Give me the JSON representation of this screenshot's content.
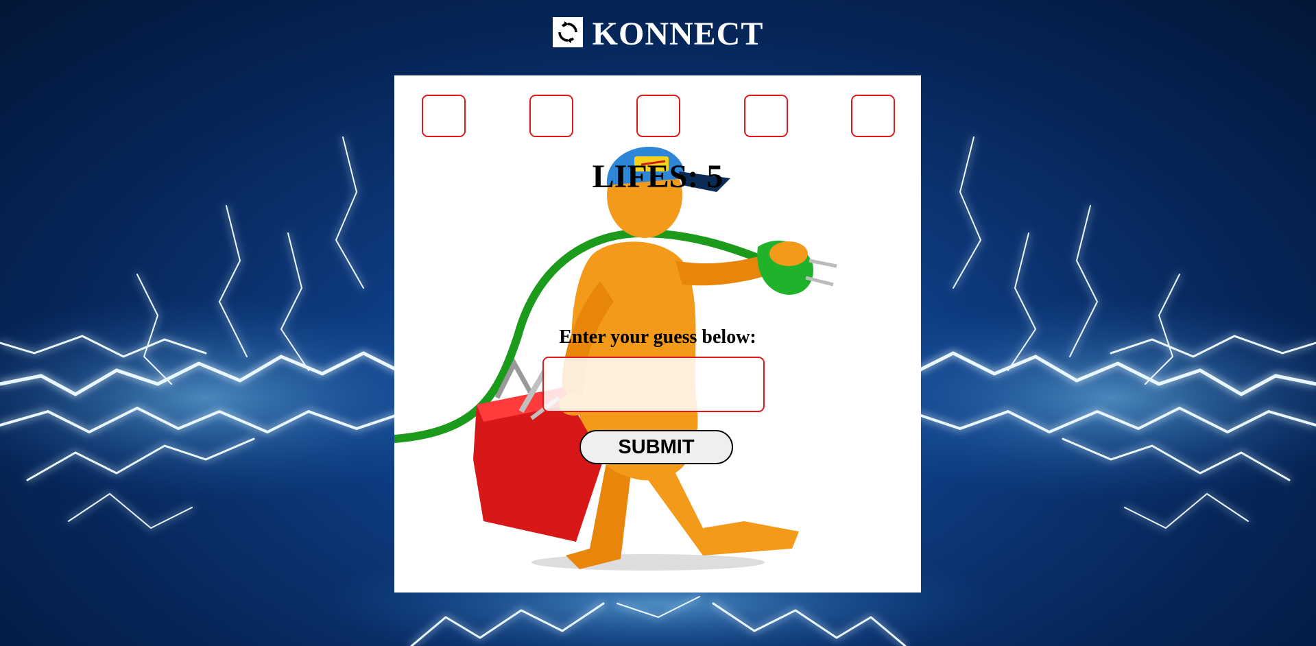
{
  "header": {
    "logo_icon": "refresh-icon",
    "title": "KONNECT"
  },
  "game": {
    "slot_count": 5,
    "lives_label": "LIFES: 5",
    "prompt": "Enter your guess below:",
    "guess_value": "",
    "submit_label": "SUBMIT"
  },
  "colors": {
    "slot_border": "#e01818",
    "background": "#0d3a7e",
    "panel": "#ffffff"
  }
}
